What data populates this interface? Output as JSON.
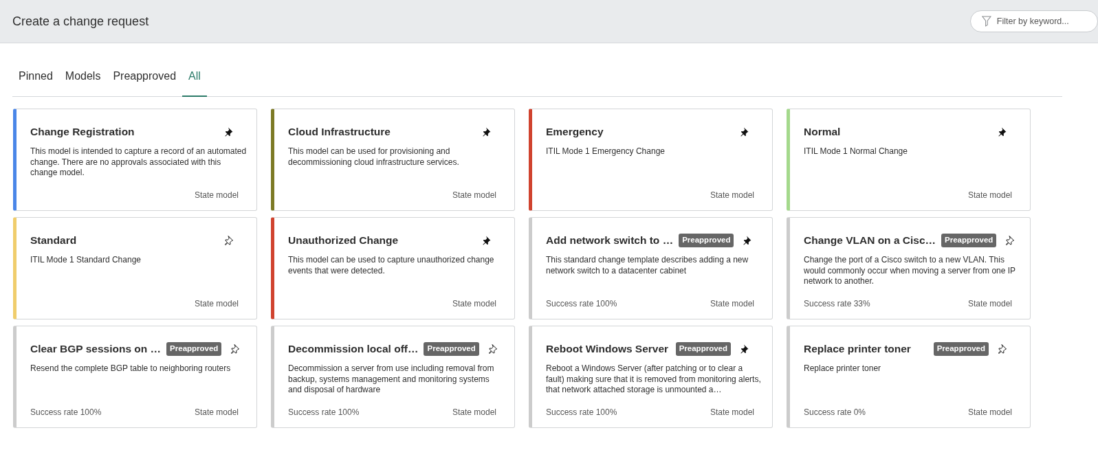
{
  "header": {
    "title": "Create a change request",
    "filter": {
      "placeholder": "Filter by keyword..."
    }
  },
  "tabs": [
    {
      "label": "Pinned",
      "selected": false
    },
    {
      "label": "Models",
      "selected": false
    },
    {
      "label": "Preapproved",
      "selected": false
    },
    {
      "label": "All",
      "selected": true
    }
  ],
  "cards": [
    {
      "title": "Change Registration",
      "description": "This model is intended to capture a record of an automated change. There are no approvals associated with this change model.",
      "model": "State model",
      "color": "#4a86e8",
      "pinned": true
    },
    {
      "title": "Cloud Infrastructure",
      "description": "This model can be used for provisioning and decommissioning cloud infrastructure services.",
      "model": "State model",
      "color": "#7d7a26",
      "pinned": true
    },
    {
      "title": "Emergency",
      "description": "ITIL Mode 1 Emergency Change",
      "model": "State model",
      "color": "#d0432f",
      "pinned": true
    },
    {
      "title": "Normal",
      "description": "ITIL Mode 1 Normal Change",
      "model": "State model",
      "color": "#a4d98c",
      "pinned": true
    },
    {
      "title": "Standard",
      "description": "ITIL Mode 1 Standard Change",
      "model": "State model",
      "color": "#f0cd6c",
      "pinned": false
    },
    {
      "title": "Unauthorized Change",
      "description": "This model can be used to capture unauthorized change events that were detected.",
      "model": "State model",
      "color": "#d0432f",
      "pinned": true
    },
    {
      "title": "Add network switch to …",
      "badge": "Preapproved",
      "description": "This standard change template describes adding a new network switch to a datacenter cabinet",
      "success": "Success rate 100%",
      "model": "State model",
      "color": "#cccccc",
      "pinned": true
    },
    {
      "title": "Change VLAN on a Cisc…",
      "badge": "Preapproved",
      "description": "Change the port of a Cisco switch to a new VLAN. This would commonly occur when moving a server from one IP network to another.",
      "success": "Success rate 33%",
      "model": "State model",
      "color": "#cccccc",
      "pinned": false
    },
    {
      "title": "Clear BGP sessions on …",
      "badge": "Preapproved",
      "description": "Resend the complete BGP table to neighboring routers",
      "success": "Success rate 100%",
      "model": "State model",
      "color": "#cccccc",
      "pinned": false
    },
    {
      "title": "Decommission local off…",
      "badge": "Preapproved",
      "description": "Decommission a server from use including removal from backup, systems management and monitoring systems and disposal of hardware",
      "success": "Success rate 100%",
      "model": "State model",
      "color": "#cccccc",
      "pinned": false
    },
    {
      "title": "Reboot Windows Server",
      "badge": "Preapproved",
      "description": "Reboot a Windows Server (after patching or to clear a fault) making sure that it is removed from monitoring alerts, that network attached storage is unmounted a…",
      "success": "Success rate 100%",
      "model": "State model",
      "color": "#cccccc",
      "pinned": true
    },
    {
      "title": "Replace printer toner",
      "badge": "Preapproved",
      "description": "Replace printer toner",
      "success": "Success rate 0%",
      "model": "State model",
      "color": "#cccccc",
      "pinned": false
    }
  ]
}
